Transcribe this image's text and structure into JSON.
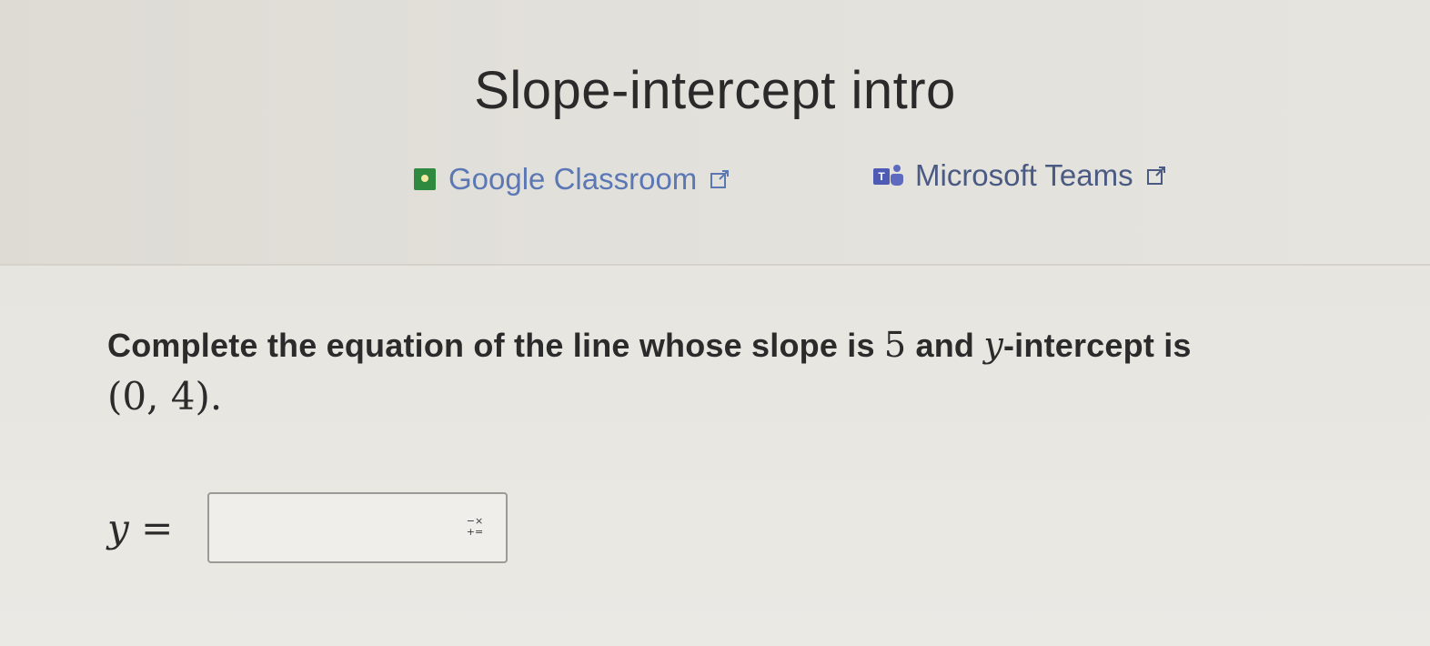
{
  "header": {
    "title": "Slope-intercept intro",
    "share_links": [
      {
        "label": "Google Classroom",
        "icon": "google-classroom-icon",
        "ext_icon": "external-link-icon"
      },
      {
        "label": "Microsoft Teams",
        "icon": "microsoft-teams-icon",
        "ext_icon": "external-link-icon"
      }
    ]
  },
  "question": {
    "text_before_slope": "Complete the equation of the line whose slope is ",
    "slope": "5",
    "text_between": " and ",
    "y_var": "y",
    "text_after": "-intercept is",
    "point": "(0, 4)."
  },
  "answer": {
    "label": "y =",
    "value": "",
    "placeholder": "",
    "keypad_icon": "math-keypad-icon"
  },
  "colors": {
    "link": "#5b78b5",
    "background": "#e6e4de",
    "text": "#2b2b2b"
  }
}
